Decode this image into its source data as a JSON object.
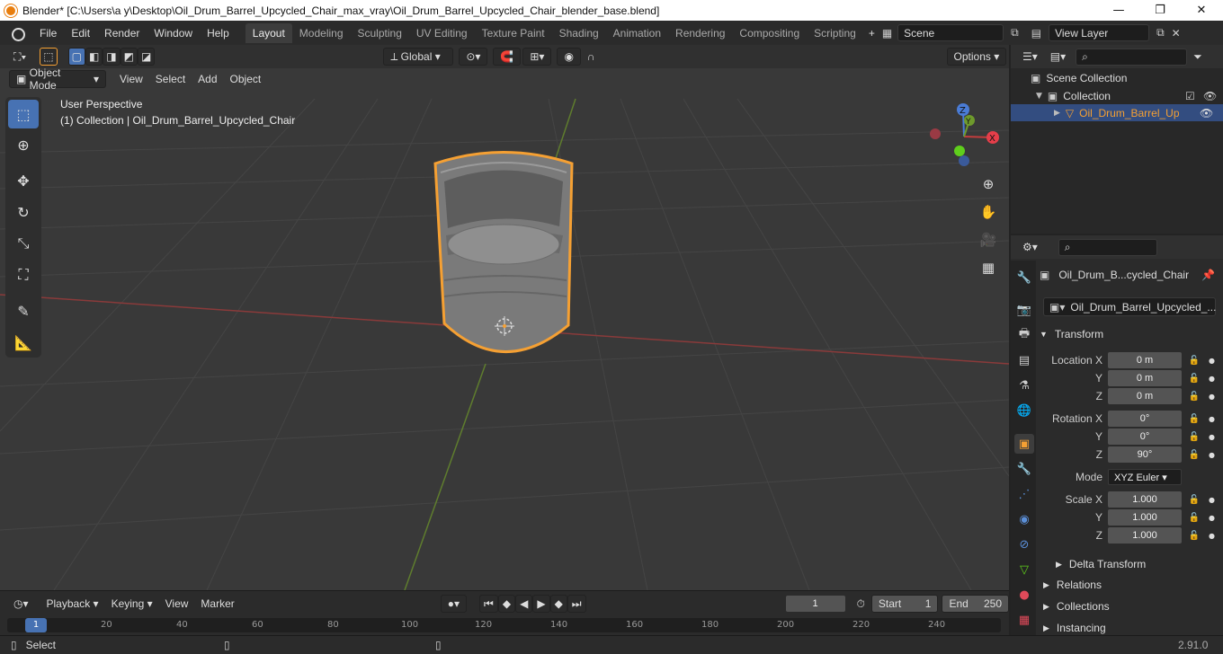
{
  "window": {
    "title": "Blender* [C:\\Users\\a y\\Desktop\\Oil_Drum_Barrel_Upcycled_Chair_max_vray\\Oil_Drum_Barrel_Upcycled_Chair_blender_base.blend]",
    "minimize": "—",
    "maximize": "❐",
    "close": "✕"
  },
  "menu": [
    "File",
    "Edit",
    "Render",
    "Window",
    "Help"
  ],
  "workspaces": [
    "Layout",
    "Modeling",
    "Sculpting",
    "UV Editing",
    "Texture Paint",
    "Shading",
    "Animation",
    "Rendering",
    "Compositing",
    "Scripting"
  ],
  "workspace_add": "+",
  "scene": {
    "name": "Scene",
    "view_layer": "View Layer"
  },
  "toolheader": {
    "orientation": "Global",
    "options": "Options"
  },
  "viewport": {
    "mode": "Object Mode",
    "menus": [
      "View",
      "Select",
      "Add",
      "Object"
    ],
    "perspective": "User Perspective",
    "collection_info": "(1) Collection | Oil_Drum_Barrel_Upcycled_Chair",
    "gizmo": {
      "x": "X",
      "y": "Y",
      "z": "Z"
    }
  },
  "outliner": {
    "scene_collection": "Scene Collection",
    "collection": "Collection",
    "object": "Oil_Drum_Barrel_Up"
  },
  "properties": {
    "object_name": "Oil_Drum_B...cycled_Chair",
    "data_name": "Oil_Drum_Barrel_Upcycled_...",
    "transform": "Transform",
    "location_label": "Location X",
    "rotation_label": "Rotation X",
    "scale_label": "Scale X",
    "y": "Y",
    "z": "Z",
    "location": [
      "0 m",
      "0 m",
      "0 m"
    ],
    "rotation": [
      "0°",
      "0°",
      "90°"
    ],
    "mode_label": "Mode",
    "mode": "XYZ Euler",
    "scale": [
      "1.000",
      "1.000",
      "1.000"
    ],
    "delta": "Delta Transform",
    "relations": "Relations",
    "collections": "Collections",
    "instancing": "Instancing"
  },
  "timeline": {
    "menus": [
      "Playback",
      "Keying",
      "View",
      "Marker"
    ],
    "current_frame": "1",
    "start_label": "Start",
    "start": "1",
    "end_label": "End",
    "end": "250",
    "ticks": [
      "1",
      "20",
      "40",
      "60",
      "80",
      "100",
      "120",
      "140",
      "160",
      "180",
      "200",
      "220",
      "240"
    ]
  },
  "status": {
    "select": "Select",
    "version": "2.91.0"
  },
  "colors": {
    "accent": "#4772b3",
    "selection": "#f5a033",
    "grid_x": "#c43d3d",
    "grid_y": "#6e9a2c"
  }
}
